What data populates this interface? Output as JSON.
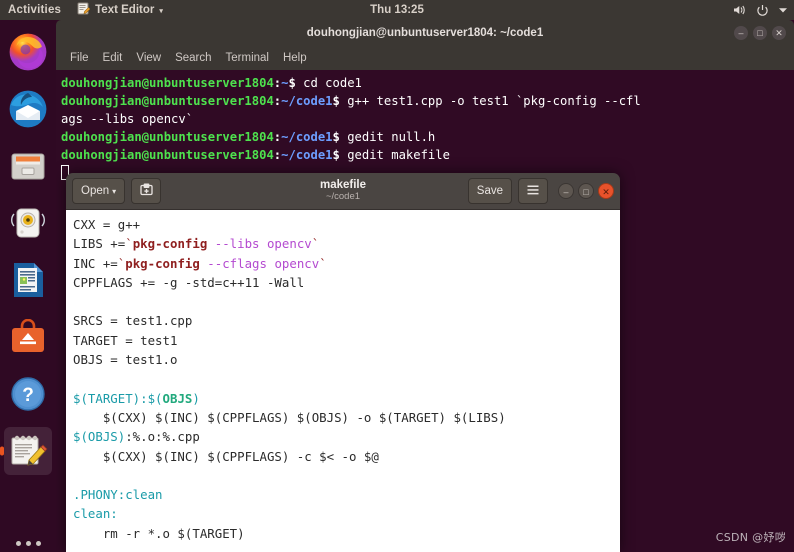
{
  "topbar": {
    "activities": "Activities",
    "app_icon": "text-editor-icon",
    "app_name": "Text Editor",
    "caret": "▾",
    "clock": "Thu 13:25",
    "tray": [
      "volume-icon",
      "power-icon",
      "chevron-down-icon"
    ]
  },
  "dock": {
    "items": [
      {
        "name": "firefox-icon",
        "label": "Firefox",
        "active": false
      },
      {
        "name": "thunderbird-icon",
        "label": "Thunderbird Mail",
        "active": false
      },
      {
        "name": "files-icon",
        "label": "Files",
        "active": false
      },
      {
        "name": "rhythmbox-icon",
        "label": "Rhythmbox",
        "active": false
      },
      {
        "name": "libreoffice-writer-icon",
        "label": "LibreOffice Writer",
        "active": false
      },
      {
        "name": "ubuntu-software-icon",
        "label": "Ubuntu Software",
        "active": false
      },
      {
        "name": "help-icon",
        "label": "Help",
        "active": false
      },
      {
        "name": "text-editor-icon",
        "label": "Text Editor",
        "active": true
      }
    ],
    "show_applications": "show-applications-icon"
  },
  "terminal": {
    "title": "douhongjian@unbuntuserver1804: ~/code1",
    "window_buttons": [
      "minimize",
      "maximize",
      "close"
    ],
    "menu": [
      "File",
      "Edit",
      "View",
      "Search",
      "Terminal",
      "Help"
    ],
    "prompt_user": "douhongjian@unbuntuserver1804",
    "lines": [
      {
        "type": "prompt",
        "path": "~",
        "command": "cd code1"
      },
      {
        "type": "prompt",
        "path": "~/code1",
        "command": "g++ test1.cpp -o test1 `pkg-config --cfl"
      },
      {
        "type": "wrap",
        "text": "ags --libs opencv`"
      },
      {
        "type": "prompt",
        "path": "~/code1",
        "command": "gedit null.h"
      },
      {
        "type": "prompt",
        "path": "~/code1",
        "command": "gedit makefile"
      },
      {
        "type": "cursor"
      }
    ],
    "watermark": "CSDN @妤哕"
  },
  "gedit": {
    "open_label": "Open",
    "open_caret": "▾",
    "new_document_icon": "new-document-icon",
    "title": "makefile",
    "subtitle": "~/code1",
    "save_label": "Save",
    "menu_icon": "hamburger-menu-icon",
    "window_buttons": [
      "minimize",
      "maximize",
      "close"
    ],
    "document": [
      [
        {
          "t": "CXX = g++",
          "c": "gk-plain"
        }
      ],
      [
        {
          "t": "LIBS +=",
          "c": "gk-plain"
        },
        {
          "t": "`",
          "c": "gk-backtick"
        },
        {
          "t": "pkg-config",
          "c": "gk-func"
        },
        {
          "t": " --libs opencv",
          "c": "gk-arg"
        },
        {
          "t": "`",
          "c": "gk-backtick"
        }
      ],
      [
        {
          "t": "INC +=",
          "c": "gk-plain"
        },
        {
          "t": "`",
          "c": "gk-backtick"
        },
        {
          "t": "pkg-config",
          "c": "gk-func"
        },
        {
          "t": " --cflags opencv",
          "c": "gk-arg"
        },
        {
          "t": "`",
          "c": "gk-backtick"
        }
      ],
      [
        {
          "t": "CPPFLAGS += -g -std=c++11 -Wall",
          "c": "gk-plain"
        }
      ],
      [
        {
          "t": "",
          "c": "gk-plain"
        }
      ],
      [
        {
          "t": "SRCS = test1.cpp",
          "c": "gk-plain"
        }
      ],
      [
        {
          "t": "TARGET = test1",
          "c": "gk-plain"
        }
      ],
      [
        {
          "t": "OBJS = test1.o",
          "c": "gk-plain"
        }
      ],
      [
        {
          "t": "",
          "c": "gk-plain"
        }
      ],
      [
        {
          "t": "$(TARGET):$(",
          "c": "gk-target"
        },
        {
          "t": "OBJS",
          "c": "gk-var"
        },
        {
          "t": ")",
          "c": "gk-target"
        }
      ],
      [
        {
          "t": "    $(CXX) $(INC) $(CPPFLAGS) $(OBJS) -o $(TARGET) $(LIBS)",
          "c": "gk-plain"
        }
      ],
      [
        {
          "t": "$(OBJS)",
          "c": "gk-target"
        },
        {
          "t": ":%.o:%.cpp",
          "c": "gk-plain"
        }
      ],
      [
        {
          "t": "    $(CXX) $(INC) $(CPPFLAGS) -c $< -o $@",
          "c": "gk-plain"
        }
      ],
      [
        {
          "t": "",
          "c": "gk-plain"
        }
      ],
      [
        {
          "t": ".PHONY:clean",
          "c": "gk-target"
        }
      ],
      [
        {
          "t": "clean:",
          "c": "gk-target"
        }
      ],
      [
        {
          "t": "    rm -r *.o $(TARGET)",
          "c": "gk-plain"
        }
      ]
    ]
  }
}
